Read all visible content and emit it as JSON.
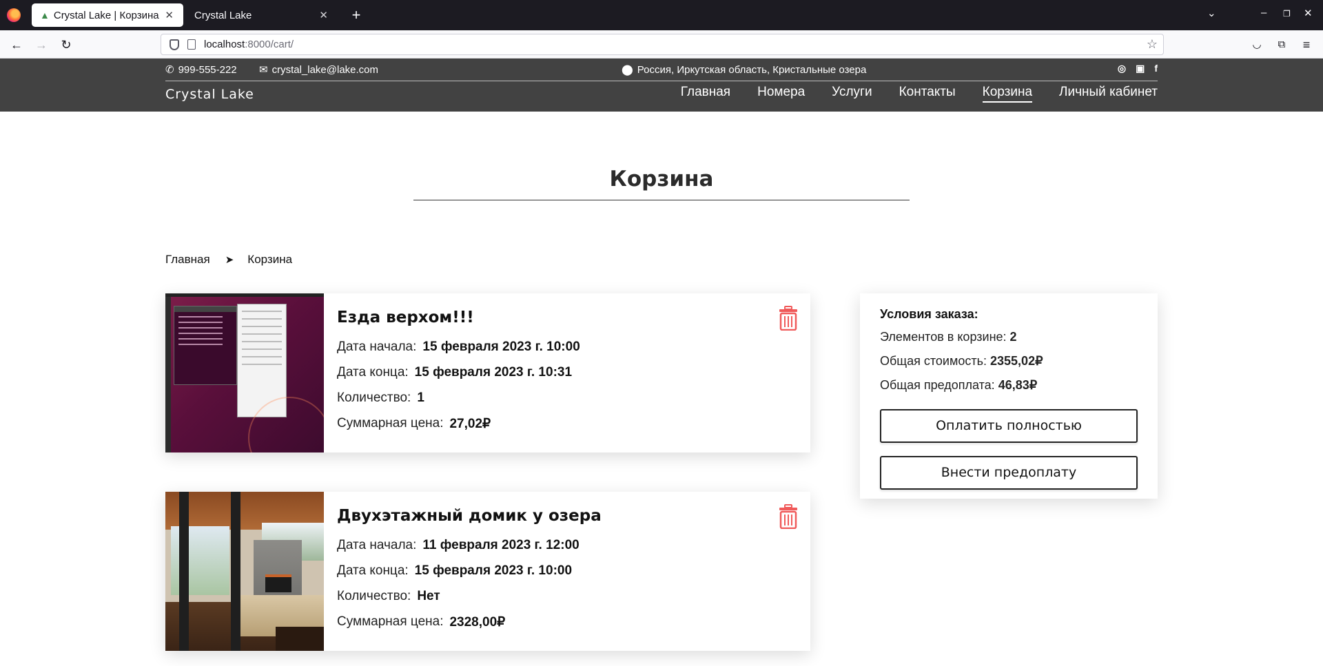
{
  "browser": {
    "tabs": [
      {
        "label": "Crystal Lake | Корзина",
        "active": true
      },
      {
        "label": "Crystal Lake",
        "active": false
      }
    ],
    "url_host": "localhost",
    "url_path": ":8000/cart/"
  },
  "header": {
    "phone": "999-555-222",
    "email": "crystal_lake@lake.com",
    "address": "Россия, Иркутская область, Кристальные озера",
    "brand": "Crystal Lake",
    "nav": [
      "Главная",
      "Номера",
      "Услуги",
      "Контакты",
      "Корзина",
      "Личный кабинет"
    ],
    "active_nav": "Корзина"
  },
  "page": {
    "title": "Корзина",
    "breadcrumb": [
      "Главная",
      "Корзина"
    ]
  },
  "cart_items": [
    {
      "title": "Езда верхом!!!",
      "start_label": "Дата начала:",
      "start": "15 февраля 2023 г. 10:00",
      "end_label": "Дата конца:",
      "end": "15 февраля 2023 г. 10:31",
      "qty_label": "Количество:",
      "qty": "1",
      "sum_label": "Суммарная цена:",
      "sum": "27,02₽"
    },
    {
      "title": "Двухэтажный домик у озера",
      "start_label": "Дата начала:",
      "start": "11 февраля 2023 г. 12:00",
      "end_label": "Дата конца:",
      "end": "15 февраля 2023 г. 10:00",
      "qty_label": "Количество:",
      "qty": "Нет",
      "sum_label": "Суммарная цена:",
      "sum": "2328,00₽"
    }
  ],
  "summary": {
    "heading": "Условия заказа:",
    "count_label": "Элементов в корзине:",
    "count": "2",
    "total_label": "Общая стоимость:",
    "total": "2355,02₽",
    "prepay_label": "Общая предоплата:",
    "prepay": "46,83₽",
    "pay_full": "Оплатить полностью",
    "pay_prepay": "Внести предоплату"
  },
  "colors": {
    "header_bg": "#424242",
    "trash": "#f05a5a"
  }
}
